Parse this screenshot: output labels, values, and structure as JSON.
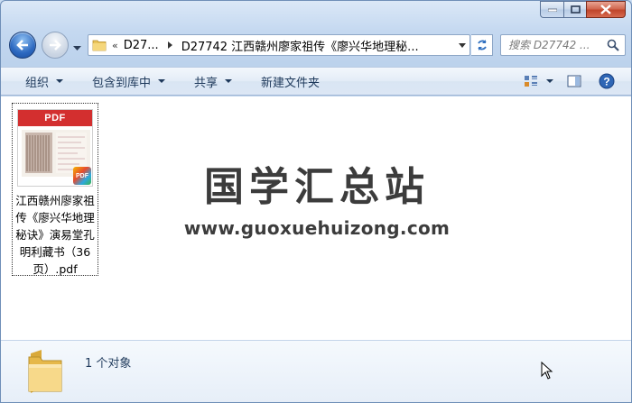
{
  "window": {
    "title": "",
    "colors": {
      "frame": "#c4d8f0",
      "close": "#c0452b",
      "accent": "#2c68c0"
    }
  },
  "address": {
    "overflow": "«",
    "crumbs": [
      "D27...",
      "D27742 江西赣州廖家祖传《廖兴华地理秘..."
    ]
  },
  "search": {
    "placeholder": "搜索 D27742 ..."
  },
  "toolbar": {
    "organize": "组织",
    "include_library": "包含到库中",
    "share": "共享",
    "new_folder": "新建文件夹",
    "icons": [
      "view-options-icon",
      "preview-pane-icon",
      "help-icon"
    ]
  },
  "file": {
    "thumb_label": "PDF",
    "badge": "PDF",
    "name": "江西赣州廖家祖传《廖兴华地理秘诀》演易堂孔明利藏书（36页）.pdf"
  },
  "watermark": {
    "title": "国学汇总站",
    "url": "www.guoxuehuizong.com"
  },
  "details": {
    "count": "1 个对象"
  }
}
